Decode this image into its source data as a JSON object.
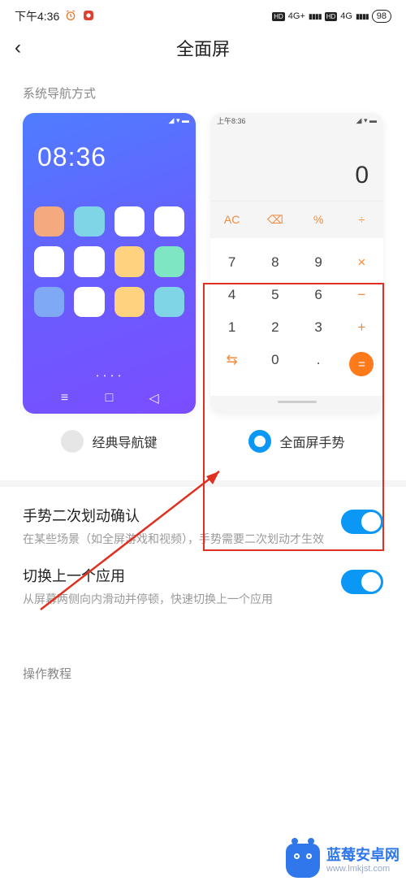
{
  "statusbar": {
    "time": "下午4:36",
    "sim1": "4G+",
    "sim2": "4G",
    "battery": "98"
  },
  "appbar": {
    "title": "全面屏",
    "back_icon": "‹"
  },
  "section": {
    "nav_label": "系统导航方式"
  },
  "options": {
    "classic": {
      "label": "经典导航键",
      "selected": false
    },
    "gesture": {
      "label": "全面屏手势",
      "selected": true
    }
  },
  "previewA": {
    "status_icons": "◢ ▾ ▬",
    "clock": "08:36",
    "icon_colors": [
      "#f5a97f",
      "#7fd4e6",
      "#ffffff",
      "#ffffff",
      "#ffffff",
      "#ffffff",
      "#ffd27f",
      "#7fe6c4",
      "#7fa9f5",
      "#ffffff",
      "#ffd27f",
      "#7fd4e6"
    ],
    "dots": "• • • •",
    "nav": {
      "menu": "≡",
      "home": "□",
      "back": "◁"
    }
  },
  "previewB": {
    "status_left": "上午8:36",
    "status_right": "◢ ▾ ▬",
    "display": "0",
    "toprow": [
      "AC",
      "⌫",
      "%",
      "÷"
    ],
    "rows": [
      [
        "7",
        "8",
        "9",
        "×"
      ],
      [
        "4",
        "5",
        "6",
        "−"
      ],
      [
        "1",
        "2",
        "3",
        "+"
      ],
      [
        "⇆",
        "0",
        ".",
        "="
      ]
    ]
  },
  "settings": {
    "gesture_confirm": {
      "title": "手势二次划动确认",
      "desc": "在某些场景（如全屏游戏和视频），手势需要二次划动才生效",
      "on": true
    },
    "switch_app": {
      "title": "切换上一个应用",
      "desc": "从屏幕两侧向内滑动并停顿，快速切换上一个应用",
      "on": true
    }
  },
  "tutorials": {
    "label": "操作教程"
  },
  "watermark": {
    "title": "蓝莓安卓网",
    "url": "www.lmkjst.com"
  }
}
